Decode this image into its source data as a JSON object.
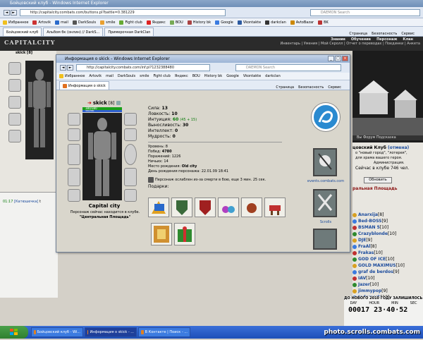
{
  "outer_browser": {
    "title": "Бойцовский клуб - Windows Internet Explorer",
    "url": "http://capitalcity.combats.com/buttons.pl?battle=0.381229",
    "search_placeholder": "DAEMON Search",
    "favorites_label": "Избранное",
    "favorites": [
      "Artovik",
      "mail",
      "DarkSouls",
      "smile",
      "Fight club",
      "Яндекс",
      "BOU",
      "History bk",
      "Google",
      "Vkontakte",
      "darkclan",
      "AvtoBazar",
      "BK"
    ],
    "tabs": [
      "Бойцовский клуб",
      "Альбом бк (онлин) // DarkS...",
      "Примерочная DarkClan"
    ],
    "tools": [
      "Страница",
      "Безопасность",
      "Сервис"
    ]
  },
  "site": {
    "logo": "CAPITALCITY",
    "nav": [
      "Знание",
      "Обучение",
      "Персонаж",
      "Клан"
    ],
    "subnav": "Инвентарь | Умения | Мой Скролл | Отчет о переводах | Поединки | Анкета",
    "left_name": "skick [8]",
    "right_club": "цовский Клуб",
    "right_club_link": "(отмена)",
    "right_news": "о \"новый город\", \"лотерея\",",
    "right_news2": "для храма вашего героя.",
    "right_admin": "Администрация.",
    "right_online": "Сейчас в клубе 746 чел.",
    "right_refresh": "Обновить",
    "right_square": "ральная Площадь",
    "right_links": "Вы Форум Подсказка",
    "chat_line_time": "01:17",
    "chat_line_name": "[Катюшечка]",
    "chat_line_extra": "t",
    "counter_label": "ДО НОВОГО 2010 ГОДУ ЗАЛИШИЛОСЬ",
    "counter_units": [
      "DAY",
      "HOUR",
      "MIN",
      "SEC"
    ],
    "counter_value": "00017 23·40·52",
    "watermark": "photo.scrolls.combats.com"
  },
  "players": [
    {
      "name": "Anarxija",
      "level": "[8]",
      "color": "#1a4a9c"
    },
    {
      "name": "Bed-BOSS",
      "level": "[9]",
      "color": "#1a4a9c"
    },
    {
      "name": "BSMAN 5",
      "level": "[10]",
      "color": "#1a4a9c"
    },
    {
      "name": "Crazyblonde",
      "level": "[10]",
      "color": "#1a4a9c"
    },
    {
      "name": "DJE",
      "level": "[9]",
      "color": "#1a4a9c"
    },
    {
      "name": "FraAl",
      "level": "[8]",
      "color": "#1a4a9c"
    },
    {
      "name": "Frakas",
      "level": "[10]",
      "color": "#1a4a9c"
    },
    {
      "name": "GOD OF ICE",
      "level": "[10]",
      "color": "#1a4a9c"
    },
    {
      "name": "GOLD MAXIMUS",
      "level": "[10]",
      "color": "#1a4a9c"
    },
    {
      "name": "graf de berdos",
      "level": "[9]",
      "color": "#1a4a9c"
    },
    {
      "name": "IAV",
      "level": "[10]",
      "color": "#1a4a9c"
    },
    {
      "name": "Jazer",
      "level": "[10]",
      "color": "#1a4a9c"
    },
    {
      "name": "jimmypop",
      "level": "[9]",
      "color": "#1a4a9c"
    },
    {
      "name": "Jodomerk",
      "level": "[10]",
      "color": "#1a4a9c"
    }
  ],
  "popup": {
    "title": "Информация о skick - Windows Internet Explorer",
    "url": "http://capitalcity.combats.com/inf.pl?1232388480",
    "search_placeholder": "DAEMON Search",
    "favorites_label": "Избранное",
    "favorites": [
      "Artovik",
      "mail",
      "DarkSouls",
      "smile",
      "Fight club",
      "Яндекс",
      "BOU",
      "History bk",
      "Google",
      "Vkontakte",
      "darkclan"
    ],
    "tab_label": "Информация о skick",
    "tools": [
      "Страница",
      "Безопасность",
      "Сервис"
    ],
    "char_name": "skick",
    "char_level": "[8]",
    "hp": "380/380",
    "mp": "380/380",
    "city": "Capital city",
    "location_label": "Персонаж сейчас находится в клубе.",
    "location": "\"Центральная Площадь\"",
    "stats": [
      {
        "label": "Сила:",
        "value": "13",
        "extra": ""
      },
      {
        "label": "Ловкость:",
        "value": "10",
        "extra": ""
      },
      {
        "label": "Интуиция:",
        "value": "60",
        "extra": "(45 + 15)"
      },
      {
        "label": "Выносливость:",
        "value": "30",
        "extra": ""
      },
      {
        "label": "Интеллект:",
        "value": "0",
        "extra": ""
      },
      {
        "label": "Мудрость:",
        "value": "0",
        "extra": ""
      }
    ],
    "info": [
      {
        "label": "Уровень:",
        "value": "8"
      },
      {
        "label": "Побед:",
        "value": "4780"
      },
      {
        "label": "Поражений:",
        "value": "1226"
      },
      {
        "label": "Ничьих:",
        "value": "14"
      },
      {
        "label": "Место рождения:",
        "value": "Old city"
      },
      {
        "label": "День рождения персонажа:",
        "value": "22.01.09 18:41"
      }
    ],
    "warning": "Персонаж ослаблен из-за смерти в бою, еще 3 мин. 25 сек.",
    "gifts_label": "Подарки:",
    "side_link": "events.combats.com",
    "side_link2": "Scrolls"
  },
  "taskbar": {
    "start": "",
    "tasks": [
      "Бойцовский клуб - Wi...",
      "Информация о skick - ...",
      "В Контакте | Поиск - ..."
    ]
  },
  "colors": {
    "accent": "#1a4a9c",
    "site_bg": "#2b2b2b",
    "xp_blue": "#1e4fb8"
  }
}
